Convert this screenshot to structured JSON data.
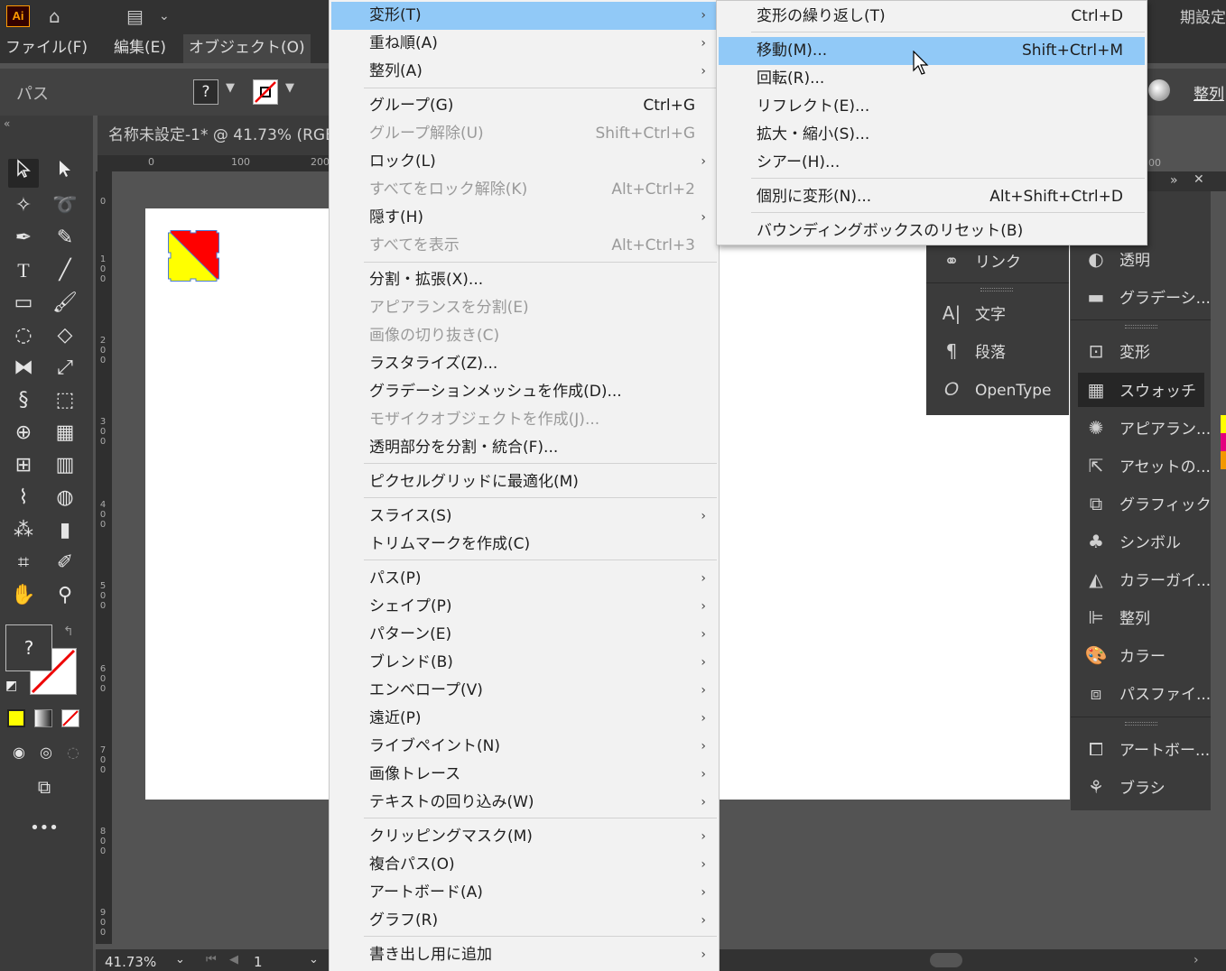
{
  "topbar": {
    "logo": "Ai",
    "workspace": "期設定"
  },
  "menubar": {
    "items": [
      "ファイル(F)",
      "編集(E)",
      "オブジェクト(O)"
    ]
  },
  "controlbar": {
    "label": "パス",
    "fill_unknown": "?",
    "align_label": "整列"
  },
  "document": {
    "tab_title": "名称未設定-1* @ 41.73% (RGB",
    "ruler_top": [
      "0",
      "100",
      "200"
    ],
    "ruler_left": [
      "0",
      "100",
      "200",
      "300",
      "400",
      "500",
      "600",
      "700",
      "800",
      "900"
    ],
    "zoom": "41.73%",
    "page": "1",
    "ruler_top_right": "00"
  },
  "colors": {
    "fill_yellow": "#ffff00",
    "fill_red": "#ff0000",
    "selection_blue": "#4a7bd4",
    "menu_highlight": "#91c9f7"
  },
  "tools": {
    "fill_unknown": "?"
  },
  "main_menu": {
    "items": [
      {
        "label": "変形(T)",
        "shortcut": "",
        "submenu": true,
        "disabled": false,
        "highlighted": true
      },
      {
        "label": "重ね順(A)",
        "shortcut": "",
        "submenu": true,
        "disabled": false
      },
      {
        "label": "整列(A)",
        "shortcut": "",
        "submenu": true,
        "disabled": false
      },
      {
        "label": "グループ(G)",
        "shortcut": "Ctrl+G",
        "submenu": false,
        "disabled": false
      },
      {
        "label": "グループ解除(U)",
        "shortcut": "Shift+Ctrl+G",
        "submenu": false,
        "disabled": true
      },
      {
        "label": "ロック(L)",
        "shortcut": "",
        "submenu": true,
        "disabled": false
      },
      {
        "label": "すべてをロック解除(K)",
        "shortcut": "Alt+Ctrl+2",
        "submenu": false,
        "disabled": true
      },
      {
        "label": "隠す(H)",
        "shortcut": "",
        "submenu": true,
        "disabled": false
      },
      {
        "label": "すべてを表示",
        "shortcut": "Alt+Ctrl+3",
        "submenu": false,
        "disabled": true
      },
      {
        "label": "分割・拡張(X)...",
        "shortcut": "",
        "submenu": false,
        "disabled": false
      },
      {
        "label": "アピアランスを分割(E)",
        "shortcut": "",
        "submenu": false,
        "disabled": true
      },
      {
        "label": "画像の切り抜き(C)",
        "shortcut": "",
        "submenu": false,
        "disabled": true
      },
      {
        "label": "ラスタライズ(Z)...",
        "shortcut": "",
        "submenu": false,
        "disabled": false
      },
      {
        "label": "グラデーションメッシュを作成(D)...",
        "shortcut": "",
        "submenu": false,
        "disabled": false
      },
      {
        "label": "モザイクオブジェクトを作成(J)...",
        "shortcut": "",
        "submenu": false,
        "disabled": true
      },
      {
        "label": "透明部分を分割・統合(F)...",
        "shortcut": "",
        "submenu": false,
        "disabled": false
      },
      {
        "label": "ピクセルグリッドに最適化(M)",
        "shortcut": "",
        "submenu": false,
        "disabled": false
      },
      {
        "label": "スライス(S)",
        "shortcut": "",
        "submenu": true,
        "disabled": false
      },
      {
        "label": "トリムマークを作成(C)",
        "shortcut": "",
        "submenu": false,
        "disabled": false
      },
      {
        "label": "パス(P)",
        "shortcut": "",
        "submenu": true,
        "disabled": false
      },
      {
        "label": "シェイプ(P)",
        "shortcut": "",
        "submenu": true,
        "disabled": false
      },
      {
        "label": "パターン(E)",
        "shortcut": "",
        "submenu": true,
        "disabled": false
      },
      {
        "label": "ブレンド(B)",
        "shortcut": "",
        "submenu": true,
        "disabled": false
      },
      {
        "label": "エンベロープ(V)",
        "shortcut": "",
        "submenu": true,
        "disabled": false
      },
      {
        "label": "遠近(P)",
        "shortcut": "",
        "submenu": true,
        "disabled": false
      },
      {
        "label": "ライブペイント(N)",
        "shortcut": "",
        "submenu": true,
        "disabled": false
      },
      {
        "label": "画像トレース",
        "shortcut": "",
        "submenu": true,
        "disabled": false
      },
      {
        "label": "テキストの回り込み(W)",
        "shortcut": "",
        "submenu": true,
        "disabled": false
      },
      {
        "label": "クリッピングマスク(M)",
        "shortcut": "",
        "submenu": true,
        "disabled": false
      },
      {
        "label": "複合パス(O)",
        "shortcut": "",
        "submenu": true,
        "disabled": false
      },
      {
        "label": "アートボード(A)",
        "shortcut": "",
        "submenu": true,
        "disabled": false
      },
      {
        "label": "グラフ(R)",
        "shortcut": "",
        "submenu": true,
        "disabled": false
      },
      {
        "label": "書き出し用に追加",
        "shortcut": "",
        "submenu": true,
        "disabled": false
      }
    ]
  },
  "sub_menu": {
    "items": [
      {
        "label": "変形の繰り返し(T)",
        "shortcut": "Ctrl+D",
        "highlighted": false
      },
      {
        "label": "移動(M)...",
        "shortcut": "Shift+Ctrl+M",
        "highlighted": true
      },
      {
        "label": "回転(R)...",
        "shortcut": "",
        "highlighted": false
      },
      {
        "label": "リフレクト(E)...",
        "shortcut": "",
        "highlighted": false
      },
      {
        "label": "拡大・縮小(S)...",
        "shortcut": "",
        "highlighted": false
      },
      {
        "label": "シアー(H)...",
        "shortcut": "",
        "highlighted": false
      },
      {
        "label": "個別に変形(N)...",
        "shortcut": "Alt+Shift+Ctrl+D",
        "highlighted": false
      },
      {
        "label": "バウンディングボックスのリセット(B)",
        "shortcut": "",
        "highlighted": false
      }
    ]
  },
  "panels_col1": {
    "items": [
      {
        "label": "リンク",
        "icon": "link-icon"
      },
      {
        "label": "文字",
        "icon": "character-icon"
      },
      {
        "label": "段落",
        "icon": "paragraph-icon"
      },
      {
        "label": "OpenType",
        "icon": "opentype-icon"
      }
    ]
  },
  "panels_col2": {
    "items": [
      {
        "label": "透明",
        "icon": "transparency-icon"
      },
      {
        "label": "グラデーシ...",
        "icon": "gradient-icon"
      },
      {
        "label": "変形",
        "icon": "transform-icon"
      },
      {
        "label": "スウォッチ",
        "icon": "swatches-icon",
        "selected": true
      },
      {
        "label": "アピアラン...",
        "icon": "appearance-icon"
      },
      {
        "label": "アセットの...",
        "icon": "asset-export-icon"
      },
      {
        "label": "グラフィック...",
        "icon": "graphic-styles-icon"
      },
      {
        "label": "シンボル",
        "icon": "symbols-icon"
      },
      {
        "label": "カラーガイ...",
        "icon": "color-guide-icon"
      },
      {
        "label": "整列",
        "icon": "align-icon"
      },
      {
        "label": "カラー",
        "icon": "color-icon"
      },
      {
        "label": "パスファイ...",
        "icon": "pathfinder-icon"
      },
      {
        "label": "アートボー...",
        "icon": "artboards-icon"
      },
      {
        "label": "ブラシ",
        "icon": "brushes-icon"
      }
    ]
  }
}
